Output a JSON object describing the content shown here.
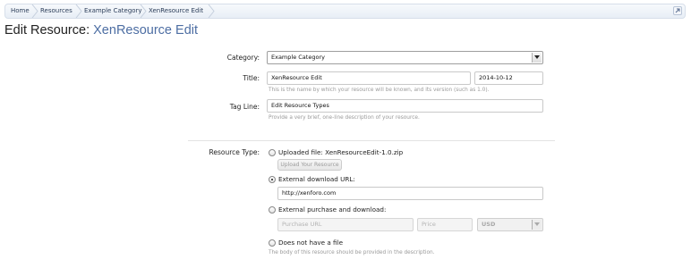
{
  "breadcrumb": {
    "items": [
      "Home",
      "Resources",
      "Example Category",
      "XenResource Edit"
    ]
  },
  "page": {
    "title_prefix": "Edit Resource:",
    "title_name": "XenResource Edit"
  },
  "form": {
    "category": {
      "label": "Category:",
      "value": "Example Category"
    },
    "title": {
      "label": "Title:",
      "value": "XenResource Edit",
      "version": "2014-10-12",
      "hint": "This is the name by which your resource will be known, and its version (such as 1.0)."
    },
    "tagline": {
      "label": "Tag Line:",
      "value": "Edit Resource Types",
      "hint": "Provide a very brief, one-line description of your resource."
    },
    "resource_type": {
      "label": "Resource Type:",
      "uploaded": {
        "label": "Uploaded file: XenResourceEdit-1.0.zip",
        "button": "Upload Your Resource",
        "selected": false
      },
      "external": {
        "label": "External download URL:",
        "url": "http://xenforo.com",
        "selected": true
      },
      "purchase": {
        "label": "External purchase and download:",
        "url_placeholder": "Purchase URL",
        "price_placeholder": "Price",
        "currency": "USD",
        "selected": false
      },
      "none": {
        "label": "Does not have a file",
        "hint": "The body of this resource should be provided in the description.",
        "selected": false
      }
    }
  }
}
